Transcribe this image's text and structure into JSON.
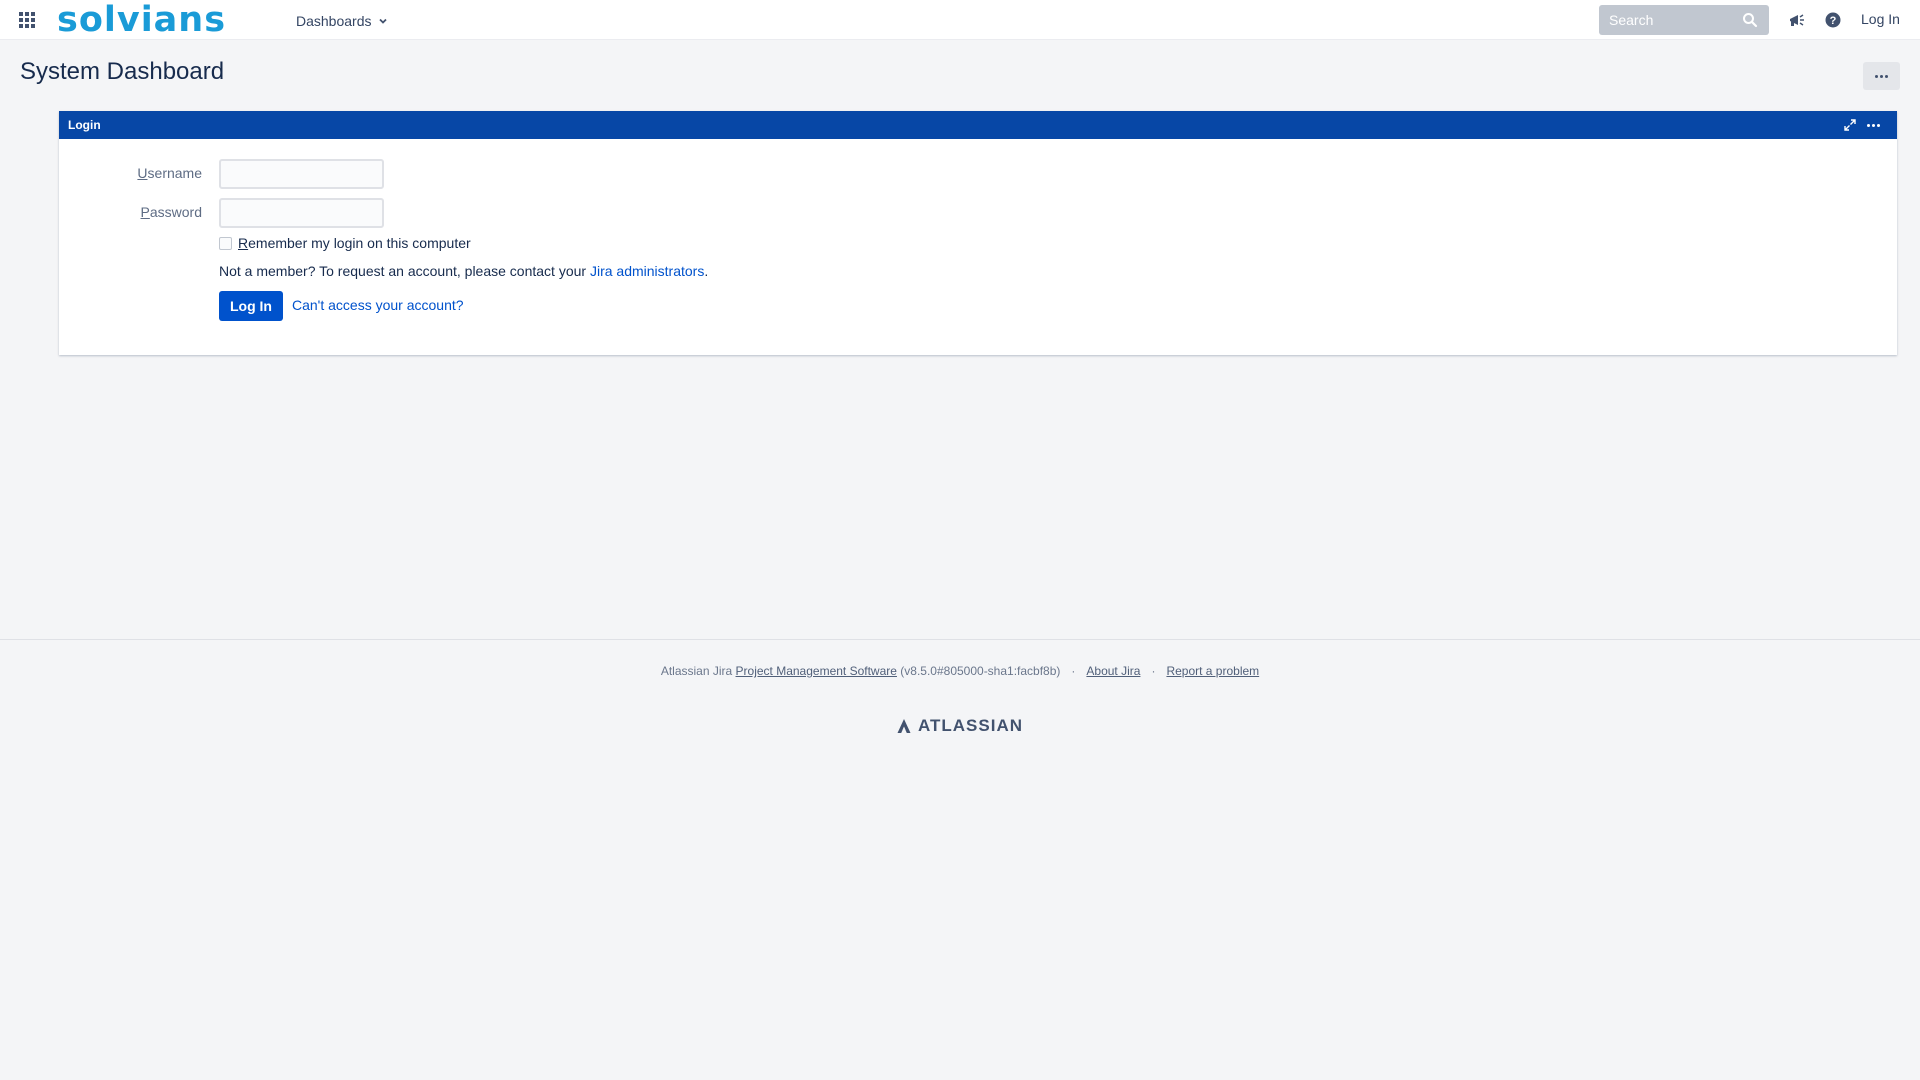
{
  "header": {
    "brand": "solvians",
    "nav_dashboards": "Dashboards",
    "search_placeholder": "Search",
    "login_label": "Log In"
  },
  "page": {
    "title": "System Dashboard"
  },
  "gadget": {
    "title": "Login",
    "username_label_first": "U",
    "username_label_rest": "sername",
    "password_label_first": "P",
    "password_label_rest": "assword",
    "username_value": "",
    "password_value": "",
    "remember_first": "R",
    "remember_rest": "emember my login on this computer",
    "not_member_text": "Not a member? To request an account, please contact your ",
    "admins_link": "Jira administrators",
    "period": ".",
    "login_button": "Log In",
    "cant_access": "Can't access your account?"
  },
  "footer": {
    "prefix": "Atlassian Jira ",
    "pm_link": "Project Management Software",
    "version": " (v8.5.0#805000-sha1:facbf8b)",
    "about_link": "About Jira",
    "report_link": "Report a problem",
    "separator": "·",
    "atlassian": "ATLASSIAN"
  },
  "colors": {
    "brand_blue": "#0747a6",
    "link_blue": "#0052cc",
    "logo_teal": "#1a9bd7"
  }
}
